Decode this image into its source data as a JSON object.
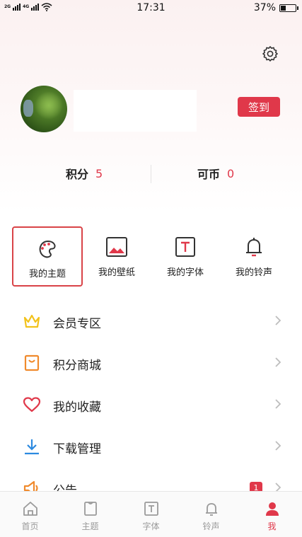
{
  "status_bar": {
    "signal1": "2G",
    "signal2": "4G",
    "time": "17:31",
    "battery": "37%",
    "battery_level": 0.37
  },
  "profile": {
    "checkin_label": "签到"
  },
  "stats": [
    {
      "label": "积分",
      "value": "5"
    },
    {
      "label": "可币",
      "value": "0"
    }
  ],
  "quick_actions": [
    {
      "label": "我的主题",
      "icon": "palette-icon",
      "selected": true
    },
    {
      "label": "我的壁纸",
      "icon": "picture-icon",
      "selected": false
    },
    {
      "label": "我的字体",
      "icon": "font-icon",
      "selected": false
    },
    {
      "label": "我的铃声",
      "icon": "bell-icon",
      "selected": false
    }
  ],
  "menu": [
    {
      "label": "会员专区",
      "icon": "crown-icon"
    },
    {
      "label": "积分商城",
      "icon": "shopping-bag-icon"
    },
    {
      "label": "我的收藏",
      "icon": "heart-icon"
    },
    {
      "label": "下载管理",
      "icon": "download-icon"
    },
    {
      "label": "公告",
      "icon": "megaphone-icon",
      "badge": "1"
    }
  ],
  "tabs": [
    {
      "label": "首页",
      "icon": "home-icon"
    },
    {
      "label": "主题",
      "icon": "shirt-icon"
    },
    {
      "label": "字体",
      "icon": "font-tab-icon"
    },
    {
      "label": "铃声",
      "icon": "bell-tab-icon"
    },
    {
      "label": "我",
      "icon": "person-icon",
      "active": true
    }
  ],
  "colors": {
    "accent": "#e0384a",
    "crown": "#f2c21b",
    "bag": "#f08a2c",
    "heart": "#e0384a",
    "download": "#2c8ae0",
    "megaphone": "#f08a2c"
  }
}
